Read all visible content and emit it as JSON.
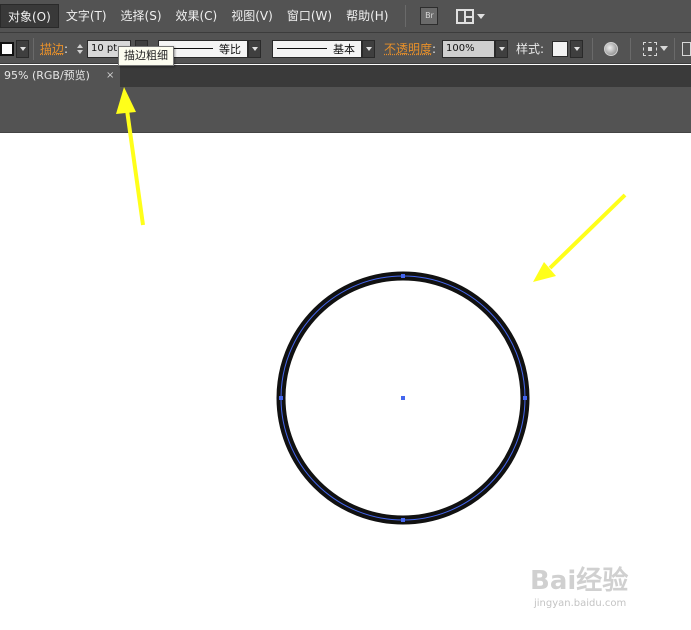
{
  "menu": {
    "items": [
      {
        "label": "对象(O)",
        "active": true
      },
      {
        "label": "文字(T)",
        "active": false
      },
      {
        "label": "选择(S)",
        "active": false
      },
      {
        "label": "效果(C)",
        "active": false
      },
      {
        "label": "视图(V)",
        "active": false
      },
      {
        "label": "窗口(W)",
        "active": false
      },
      {
        "label": "帮助(H)",
        "active": false
      }
    ],
    "bridge_label": "Br"
  },
  "controlbar": {
    "stroke_label": "描边",
    "stroke_weight": "10 pt",
    "profile_label": "等比",
    "brush_label": "基本",
    "opacity_label": "不透明度",
    "opacity_value": "100%",
    "style_label": "样式"
  },
  "tooltip": {
    "text": "描边粗细"
  },
  "document": {
    "tab_title": "95% (RGB/预览)",
    "close_glyph": "×"
  },
  "watermark": {
    "logo": "Bai经验",
    "url": "jingyan.baidu.com"
  },
  "colors": {
    "chrome": "#535353",
    "arrow": "#ffff1a",
    "circle_stroke": "#111111",
    "selection": "#4466ee"
  }
}
